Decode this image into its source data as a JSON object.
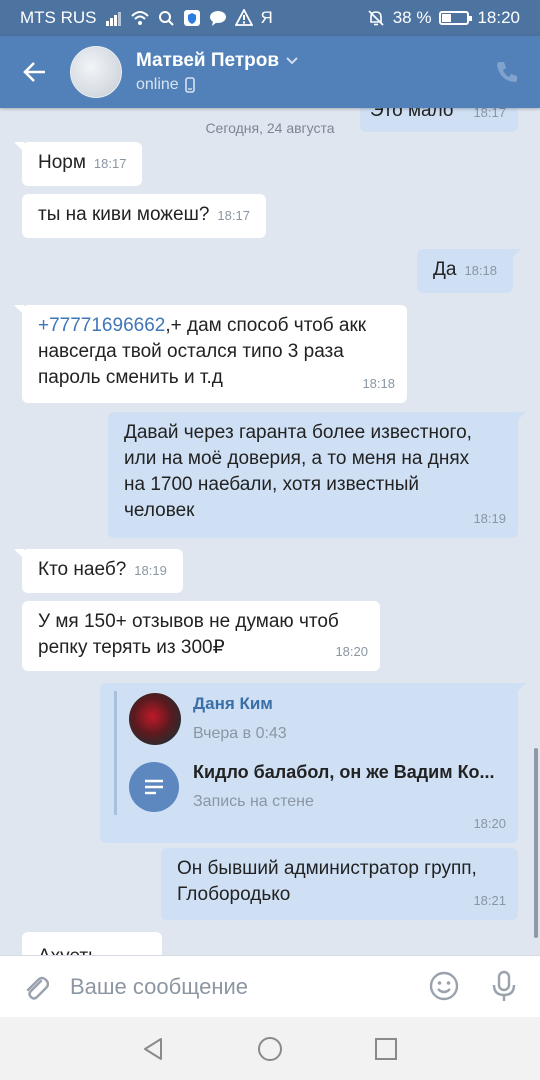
{
  "status_bar": {
    "carrier": "MTS RUS",
    "extra_glyph": "Я",
    "battery_percent": "38 %",
    "battery_level": 0.38,
    "time": "18:20"
  },
  "header": {
    "contact_name": "Матвей Петров",
    "status": "online"
  },
  "chat": {
    "partial_top_message": {
      "text": "Это мало",
      "time": "18:17"
    },
    "date_separator": "Сегодня, 24 августа",
    "messages": [
      {
        "direction": "in",
        "text": "Норм",
        "time": "18:17"
      },
      {
        "direction": "in",
        "text": "ты на киви можеш?",
        "time": "18:17"
      },
      {
        "direction": "out",
        "text": "Да",
        "time": "18:18"
      },
      {
        "direction": "in",
        "link": "+77771696662",
        "text_line1": ",+ дам способ чтоб акк",
        "text_line2": "навсегда твой остался типо 3 раза",
        "text_line3": "пароль сменить и т.д",
        "time": "18:18"
      },
      {
        "direction": "out",
        "line1": "Давай через гаранта более известного,",
        "line2": "или на моё доверия, а то меня на днях",
        "line3": "на 1700 наебали, хотя известный",
        "line4": "человек",
        "time": "18:19"
      },
      {
        "direction": "in",
        "text": "Кто наеб?",
        "time": "18:19"
      },
      {
        "direction": "in",
        "line1": "У мя 150+ отзывов не думаю чтоб",
        "line2": "репку терять из 300₽",
        "time": "18:20"
      },
      {
        "direction": "out",
        "forwarded": {
          "author": "Даня Ким",
          "date": "Вчера в 0:43",
          "attachment_title": "Кидло балабол, он же Вадим Ко...",
          "attachment_subtitle": "Запись на стене"
        },
        "time": "18:20"
      },
      {
        "direction": "out",
        "line1": "Он бывший администратор групп,",
        "line2": "Глобородько",
        "time": "18:21"
      },
      {
        "direction": "in",
        "text": "Ахуеть",
        "time": ""
      }
    ]
  },
  "input": {
    "placeholder": "Ваше сообщение"
  },
  "colors": {
    "header": "#5181b8",
    "status_bar": "#4d73a0",
    "chat_bg": "#dfe6ef",
    "outgoing_bubble": "#cfe0f5",
    "incoming_bubble": "#ffffff"
  }
}
